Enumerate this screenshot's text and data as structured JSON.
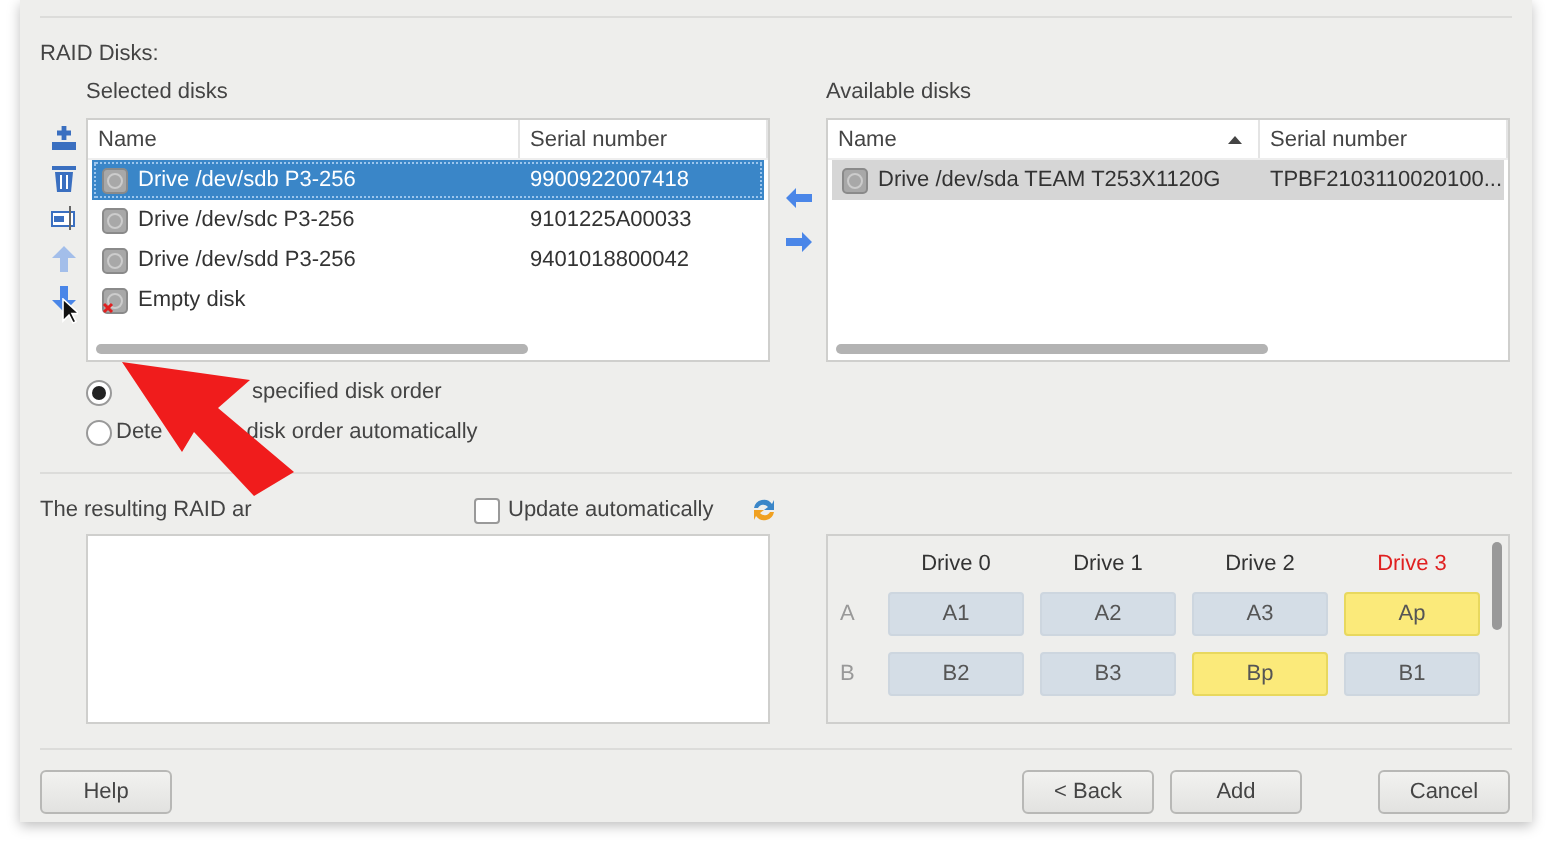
{
  "section_title": "RAID Disks:",
  "selected_disks": {
    "title": "Selected disks",
    "focused": true,
    "columns": [
      {
        "label": "Name",
        "sorted": false
      },
      {
        "label": "Serial number",
        "sorted": false
      }
    ],
    "rows": [
      {
        "name": "Drive /dev/sdb P3-256",
        "serial": "9900922007418",
        "kind": "drive",
        "selected": true
      },
      {
        "name": "Drive /dev/sdc P3-256",
        "serial": "9101225A00033",
        "kind": "drive",
        "selected": false
      },
      {
        "name": "Drive /dev/sdd P3-256",
        "serial": "9401018800042",
        "kind": "drive",
        "selected": false
      },
      {
        "name": "Empty disk",
        "serial": "",
        "kind": "empty",
        "selected": false
      }
    ]
  },
  "toolbar": [
    {
      "kind": "add",
      "disabled": false
    },
    {
      "kind": "delete",
      "disabled": false
    },
    {
      "kind": "replace",
      "disabled": false
    },
    {
      "kind": "up",
      "disabled": true
    },
    {
      "kind": "down",
      "disabled": false
    }
  ],
  "transfer_buttons": [
    {
      "kind": "left"
    },
    {
      "kind": "right"
    }
  ],
  "available_disks": {
    "title": "Available disks",
    "focused": false,
    "columns": [
      {
        "label": "Name",
        "sorted": true
      },
      {
        "label": "Serial number",
        "sorted": false
      }
    ],
    "rows": [
      {
        "name": "Drive /dev/sda TEAM T253X1120G",
        "serial": "TPBF2103110020100...",
        "kind": "drive",
        "selected": true
      }
    ]
  },
  "order_options": [
    {
      "parts": [
        "specified disk order"
      ],
      "selected": true
    },
    {
      "parts": [
        "Dete",
        "disk order automatically"
      ],
      "selected": false
    }
  ],
  "result": {
    "label": "The resulting RAID ar",
    "update_automatically": {
      "label": "Update automatically",
      "checked": false
    }
  },
  "layout": {
    "columns": [
      {
        "label": "Drive 0",
        "failed": false
      },
      {
        "label": "Drive 1",
        "failed": false
      },
      {
        "label": "Drive 2",
        "failed": false
      },
      {
        "label": "Drive 3",
        "failed": true
      }
    ],
    "rows": [
      {
        "label": "A",
        "cells": [
          {
            "text": "A1",
            "parity": false
          },
          {
            "text": "A2",
            "parity": false
          },
          {
            "text": "A3",
            "parity": false
          },
          {
            "text": "Ap",
            "parity": true
          }
        ]
      },
      {
        "label": "B",
        "cells": [
          {
            "text": "B2",
            "parity": false
          },
          {
            "text": "B3",
            "parity": false
          },
          {
            "text": "Bp",
            "parity": true
          },
          {
            "text": "B1",
            "parity": false
          }
        ]
      }
    ]
  },
  "buttons": {
    "help": "Help",
    "back": "< Back",
    "add": "Add",
    "cancel": "Cancel"
  }
}
